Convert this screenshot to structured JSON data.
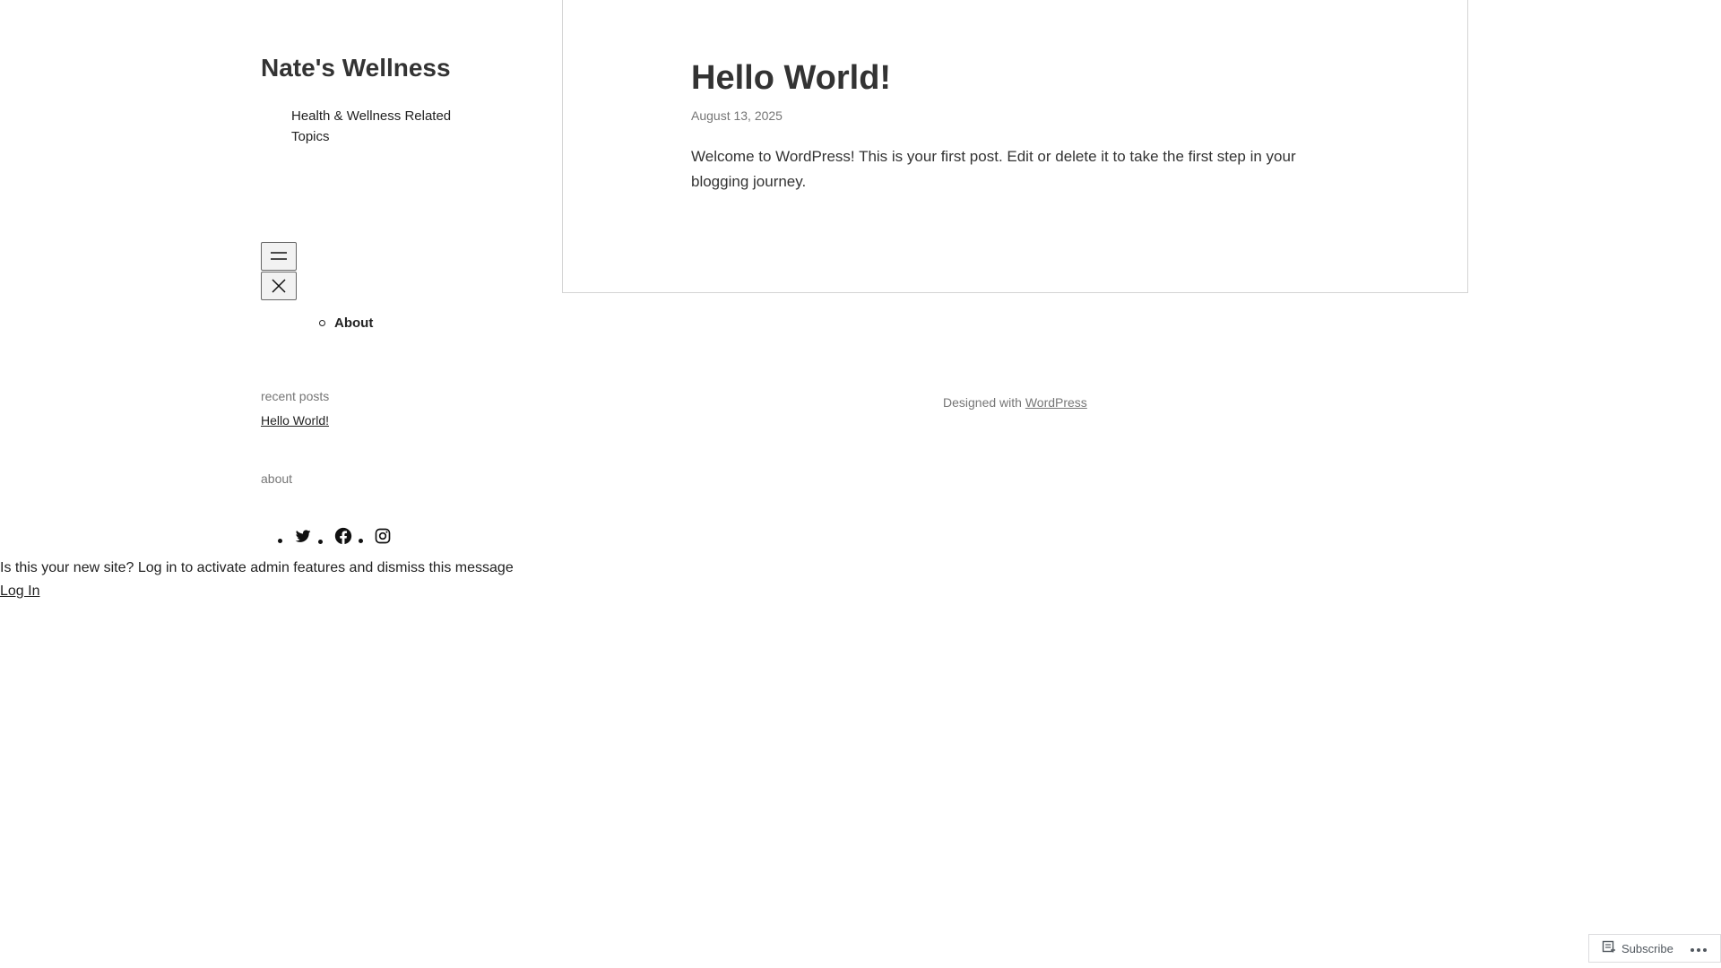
{
  "site": {
    "title": "Nate's Wellness",
    "tagline": "Health & Wellness Related Topics"
  },
  "navigation": {
    "items": [
      {
        "label": "About"
      }
    ]
  },
  "widgets": {
    "recent_posts_title": "recent posts",
    "recent_posts": [
      {
        "label": "Hello World!"
      }
    ],
    "about_title": "about",
    "social_icons": [
      "twitter-icon",
      "facebook-icon",
      "instagram-icon"
    ]
  },
  "admin_notice": {
    "message": "Is this your new site? Log in to activate admin features and dismiss this message",
    "login_label": "Log In"
  },
  "post": {
    "title": "Hello World!",
    "date": "August 13, 2025",
    "body": "Welcome to WordPress! This is your first post. Edit or delete it to take the first step in your blogging journey."
  },
  "footer": {
    "credit_prefix": "Designed with",
    "credit_link": "WordPress"
  },
  "subscribe_bar": {
    "subscribe_label": "Subscribe",
    "more_icon": "ellipsis-icon"
  }
}
